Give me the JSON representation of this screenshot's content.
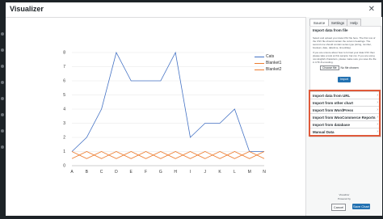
{
  "modal": {
    "title": "Visualizer",
    "close_symbol": "✕"
  },
  "sidebar": {
    "tabs": [
      "Source",
      "Settings",
      "Help"
    ],
    "open_section": {
      "title": "Import data from file",
      "description": "Select and upload your data CSV file here. The first row of the CSV file should contain the column headings. The second one should contain series type (string, number, boolean, date, datetime, timeofday).",
      "note": "If you are unsure about how to format your data CSV then please take a look at this sample: bar.csv. If you are using non-English characters, please make sure you save the file in UTF-8 encoding.",
      "file_button": "Choose file",
      "file_status": "No file chosen",
      "import_button": "Import"
    },
    "sections": [
      "Import data from URL",
      "Import from other chart",
      "Import from WordPress",
      "Import from WooCommerce Reports",
      "Import from database",
      "Manual Data"
    ],
    "footer_line1": "Visualizer",
    "footer_line2": "Powered by"
  },
  "footer": {
    "cancel_label": "Cancel",
    "save_label": "Save Chart"
  },
  "chart_data": {
    "type": "line",
    "categories": [
      "A",
      "B",
      "C",
      "D",
      "E",
      "F",
      "G",
      "H",
      "I",
      "J",
      "K",
      "L",
      "M",
      "N"
    ],
    "ylim": [
      0,
      8
    ],
    "yticks": [
      0,
      1,
      2,
      3,
      4,
      5,
      6,
      7,
      8
    ],
    "series": [
      {
        "name": "Cats",
        "color": "#4472c4",
        "values": [
          1,
          2,
          4,
          8,
          6,
          6,
          6,
          8,
          2,
          3,
          3,
          4,
          1,
          1
        ]
      },
      {
        "name": "Blanket1",
        "color": "#ed7d31",
        "values": [
          1,
          0.5,
          1,
          0.5,
          1,
          0.5,
          1,
          0.5,
          1,
          0.5,
          1,
          0.5,
          1,
          0.5
        ]
      },
      {
        "name": "Blanket2",
        "color": "#ed7d31",
        "values": [
          0.5,
          1,
          0.5,
          1,
          0.5,
          1,
          0.5,
          1,
          0.5,
          1,
          0.5,
          1,
          0.5,
          1
        ]
      }
    ]
  }
}
